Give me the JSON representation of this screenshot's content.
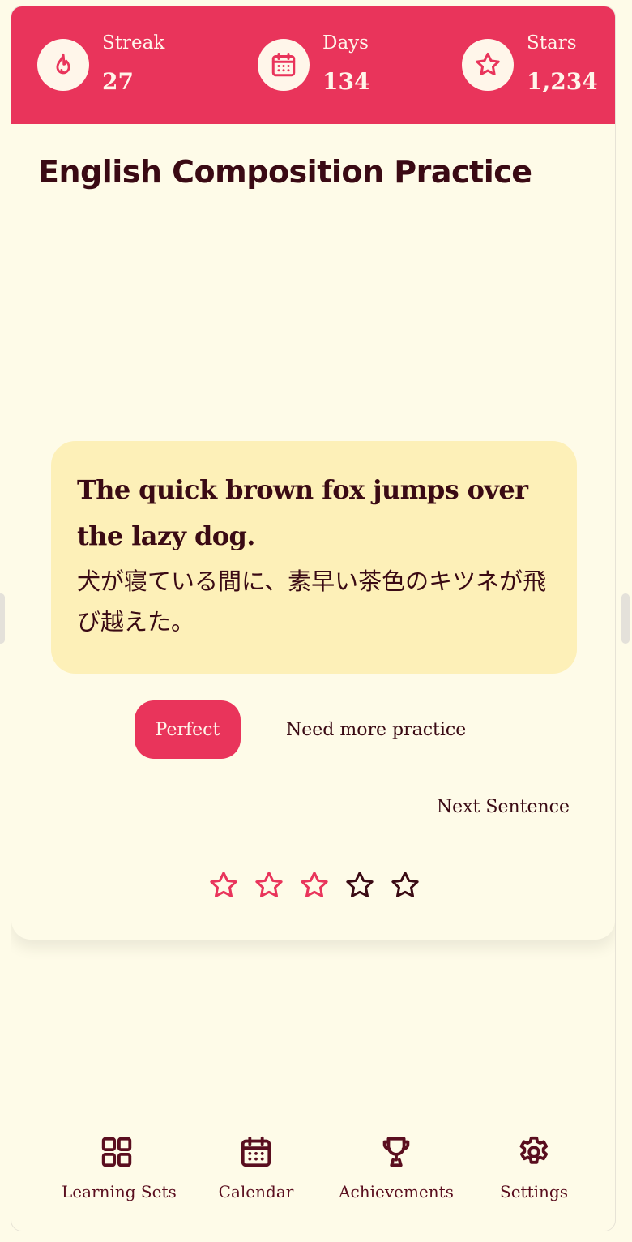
{
  "stats": {
    "streak": {
      "label": "Streak",
      "value": "27",
      "icon": "flame-icon"
    },
    "days": {
      "label": "Days",
      "value": "134",
      "icon": "calendar-icon"
    },
    "stars": {
      "label": "Stars",
      "value": "1,234",
      "icon": "star-icon"
    }
  },
  "page_title": "English Composition Practice",
  "sentence": {
    "english": "The quick brown fox jumps over the lazy dog.",
    "japanese": "犬が寝ている間に、素早い茶色のキツネが飛び越えた。"
  },
  "actions": {
    "perfect_label": "Perfect",
    "practice_label": "Need more practice",
    "next_label": "Next Sentence"
  },
  "rating": {
    "filled": 3,
    "total": 5
  },
  "nav": [
    {
      "label": "Learning Sets",
      "icon": "grid-icon"
    },
    {
      "label": "Calendar",
      "icon": "calendar-icon"
    },
    {
      "label": "Achievements",
      "icon": "trophy-icon"
    },
    {
      "label": "Settings",
      "icon": "gear-icon"
    }
  ],
  "colors": {
    "accent": "#e9345b",
    "background": "#fefbe8",
    "card": "#fdf0b8",
    "text": "#3a0a14"
  }
}
